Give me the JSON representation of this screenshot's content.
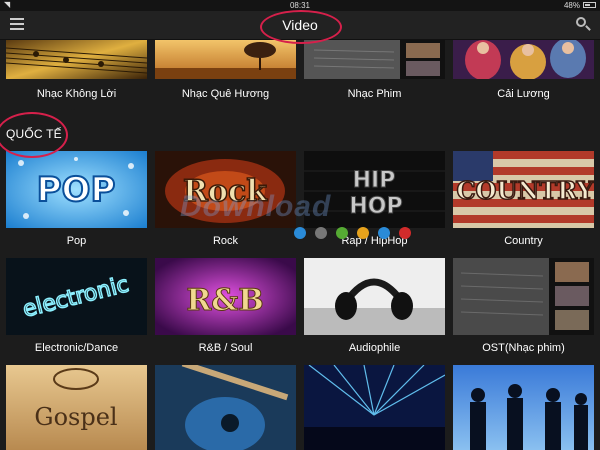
{
  "status": {
    "time": "08:31",
    "battery": "48%"
  },
  "nav": {
    "title": "Video"
  },
  "section": {
    "title": "QUỐC TẾ"
  },
  "row1": [
    {
      "label": "Nhạc Không Lời"
    },
    {
      "label": "Nhạc Quê Hương"
    },
    {
      "label": "Nhạc Phim"
    },
    {
      "label": "Cải Lương"
    }
  ],
  "row2": [
    {
      "label": "Pop",
      "art": "POP"
    },
    {
      "label": "Rock",
      "art": "Rock"
    },
    {
      "label": "Rap / HipHop",
      "art": "HIP HOP"
    },
    {
      "label": "Country",
      "art": "COUNTRY"
    }
  ],
  "row3": [
    {
      "label": "Electronic/Dance",
      "art": "electronic"
    },
    {
      "label": "R&B / Soul",
      "art": "R&B"
    },
    {
      "label": "Audiophile"
    },
    {
      "label": "OST(Nhạc phim)"
    }
  ],
  "row4": [
    {
      "art": "Gospel"
    },
    {},
    {},
    {}
  ],
  "watermark": "Download",
  "colors": {
    "annotation": "#d6204b",
    "dots": [
      "#2a8bd8",
      "#777777",
      "#55aa33",
      "#e6a21c",
      "#2a8bd8",
      "#d12b2b"
    ]
  }
}
